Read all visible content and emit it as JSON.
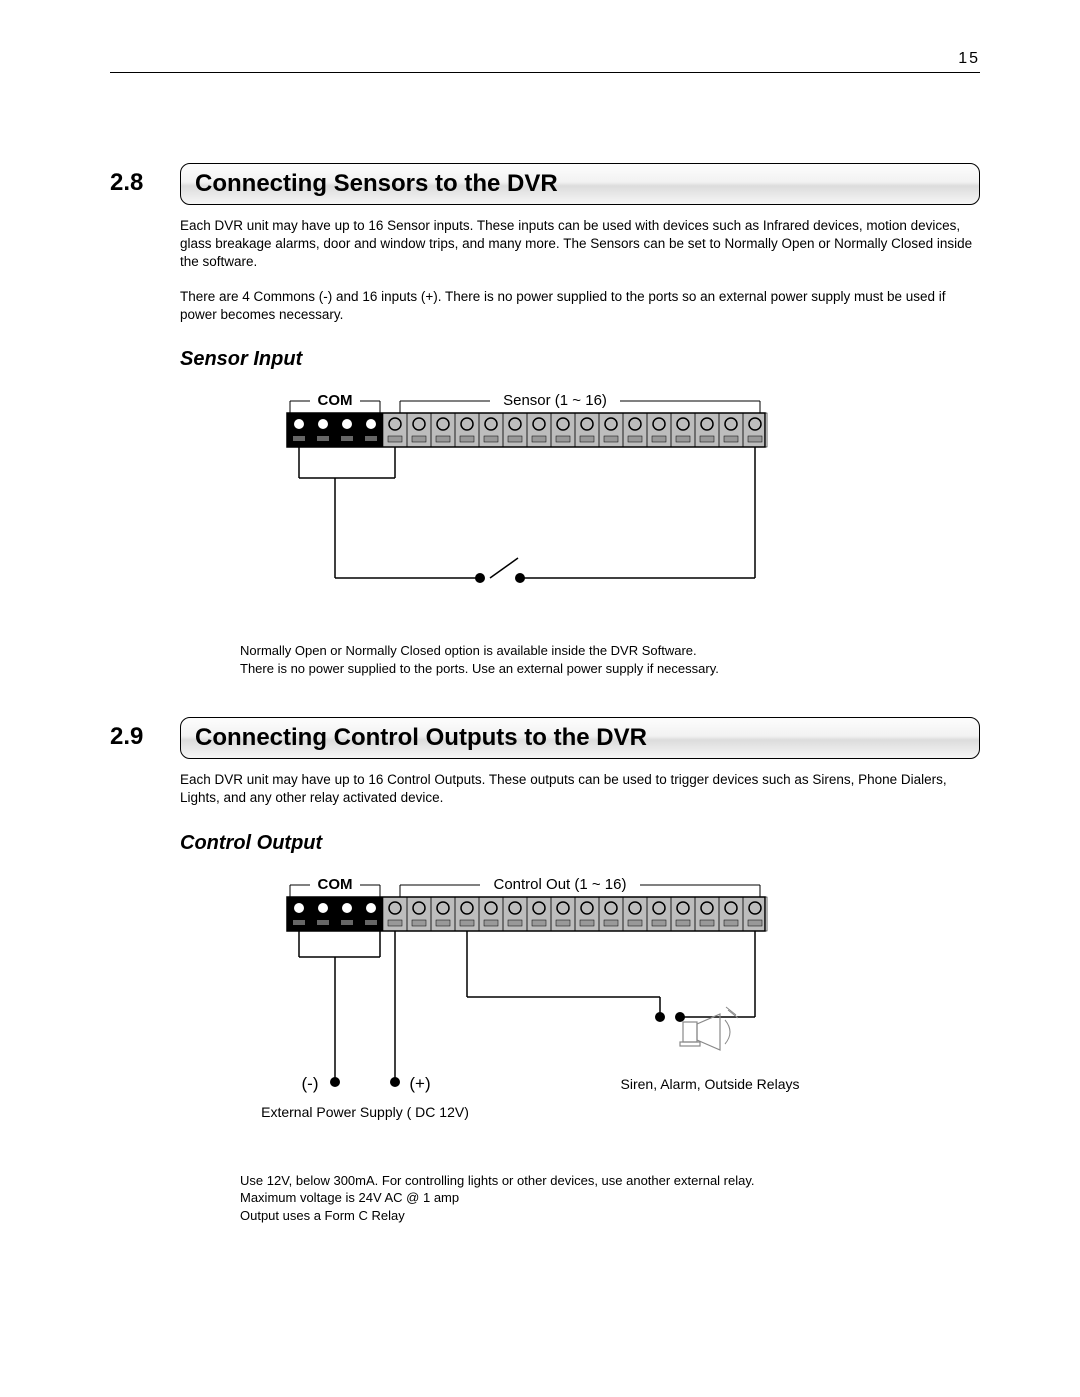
{
  "page_number": "15",
  "section1": {
    "num": "2.8",
    "title": "Connecting Sensors to the DVR",
    "para1": "Each DVR unit may have up to 16 Sensor inputs. These inputs can be used with devices such as Infrared devices, motion devices, glass breakage alarms, door and window trips, and many more. The Sensors can be set to Normally Open or Normally Closed inside the software.",
    "para2": "There are 4 Commons (-) and 16 inputs (+). There is no power supplied to the ports so an external power supply must be used if power becomes necessary.",
    "subheading": "Sensor Input",
    "diagram": {
      "com_label": "COM",
      "sensor_label": "Sensor (1 ~ 16)"
    },
    "note1": "Normally Open or Normally Closed option is available inside the DVR Software.",
    "note2": "There is no power supplied to the ports. Use an external power supply if necessary."
  },
  "section2": {
    "num": "2.9",
    "title": "Connecting Control Outputs to the DVR",
    "para1": "Each DVR unit may have up to 16 Control Outputs. These outputs can be used to trigger devices such as Sirens, Phone Dialers, Lights, and any other relay activated device.",
    "subheading": "Control Output",
    "diagram": {
      "com_label": "COM",
      "control_label": "Control Out (1 ~ 16)",
      "minus": "(-)",
      "plus": "(+)",
      "ext_power": "External Power Supply ( DC 12V)",
      "siren_label": "Siren, Alarm, Outside Relays"
    },
    "note1": "Use 12V, below 300mA. For controlling lights or other devices, use another external relay.",
    "note2": "Maximum voltage is 24V AC @ 1 amp",
    "note3": "Output uses a Form C Relay"
  }
}
